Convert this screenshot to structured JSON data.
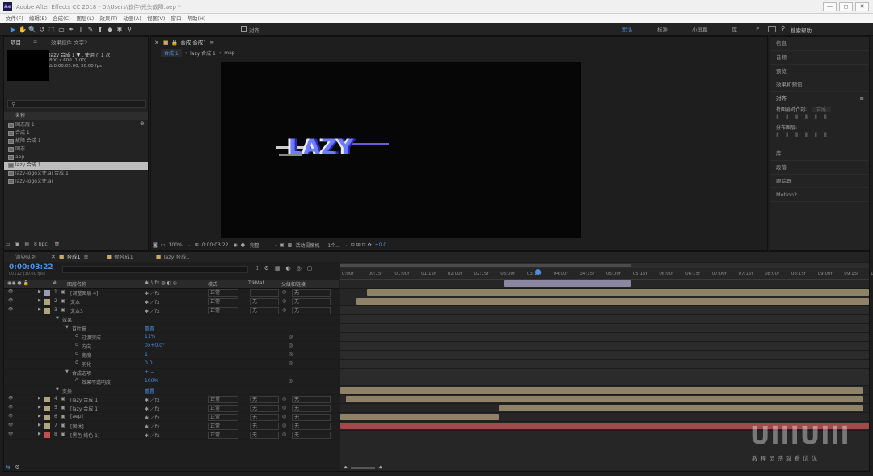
{
  "window": {
    "app_icon": "Ae",
    "title": "Adobe After Effects CC 2018 - D:\\Users\\软件\\光头故障.aep *",
    "min": "—",
    "max": "◻",
    "close": "✕"
  },
  "menu": [
    "文件(F)",
    "编辑(E)",
    "合成(C)",
    "图层(L)",
    "效果(T)",
    "动画(A)",
    "视图(V)",
    "窗口",
    "帮助(H)"
  ],
  "toolbar": {
    "tools": [
      "▶",
      "✋",
      "🔍",
      "↺",
      "⬚",
      "▭",
      "✒",
      "T",
      "✎",
      "⬆",
      "◆",
      "✱",
      "⚲"
    ],
    "snap_label": "对齐",
    "workspaces": [
      "默认",
      "标准",
      "小屏幕",
      "库"
    ],
    "active_ws": "默认",
    "more": "»",
    "search_placeholder": "搜索帮助"
  },
  "project": {
    "tab": "项目",
    "tab2": "效果控件 文字2",
    "comp_name": "lazy 合成 1 ▼ , 使用了 1 次",
    "comp_dims": "800 x 600 (1.00)",
    "comp_dur": "Δ 0:00:05:00, 30.00 fps",
    "col_name": "名称",
    "items": [
      "固态层 1",
      "合成 1",
      "故障 合成 1",
      "固态",
      "aep",
      "lazy 合成 1",
      "lazy-logo文件.ai 合成 1",
      "lazy-logo文件.ai"
    ],
    "selected_index": 5,
    "bpc": "8 bpc"
  },
  "viewer": {
    "tab": "合成 合成1",
    "breadcrumbs": [
      "合成 1",
      "lazy 合成 1",
      "map"
    ],
    "canvas_text": "LAZY",
    "zoom": "100%",
    "timecode": "0:00:03:22",
    "quality": "完整",
    "camera": "活动摄像机",
    "views": "1个...",
    "exposure": "+0.0"
  },
  "right_panel": {
    "items": [
      "信息",
      "音频",
      "预览",
      "效果和预设"
    ],
    "align": "对齐",
    "align_to_label": "将图层对齐到:",
    "align_to_value": "合成",
    "distribute": "分布图层:",
    "more_items": [
      "库",
      "段落",
      "跟踪器",
      "Motion2"
    ]
  },
  "timeline": {
    "tab_render": "渲染队列",
    "tabs": [
      "合成1",
      "预合成1",
      "lazy 合成1"
    ],
    "timecode": "0:00:03:22",
    "frame": "00112 (30.00 fps)",
    "col_headers": {
      "num": "#",
      "name": "图层名称",
      "mode": "模式",
      "trkmat": "TrkMat",
      "parent": "父级和链接"
    },
    "ruler": [
      "0:00f",
      "00:15f",
      "01:00f",
      "01:15f",
      "02:00f",
      "02:15f",
      "03:00f",
      "03:15f",
      "04:00f",
      "04:15f",
      "05:00f",
      "05:15f",
      "06:00f",
      "06:15f",
      "07:00f",
      "07:15f",
      "08:00f",
      "08:15f",
      "09:00f",
      "09:15f",
      "10:0"
    ],
    "layers": [
      {
        "num": "1",
        "name": "[调整图层 4]",
        "mode": "正常",
        "trk": "",
        "parent": "无",
        "color": "#9b9bb8",
        "bar_start": 0.31,
        "bar_end": 0.55,
        "bar_color": "#8b87a0"
      },
      {
        "num": "2",
        "name": "文本",
        "mode": "正常",
        "trk": "无",
        "parent": "无",
        "color": "#b2a47f",
        "bar_start": 0.05,
        "bar_end": 1.0
      },
      {
        "num": "3",
        "name": "文本3",
        "mode": "正常",
        "trk": "无",
        "parent": "无",
        "color": "#b2a47f",
        "bar_start": 0.03,
        "bar_end": 1.0
      },
      {
        "num": "4",
        "name": "[lazy 合成 1]",
        "mode": "正常",
        "trk": "无",
        "parent": "无",
        "color": "#b2a47f",
        "bar_start": 0.0,
        "bar_end": 0.99
      },
      {
        "num": "5",
        "name": "[lazy 合成 1]",
        "mode": "正常",
        "trk": "无",
        "parent": "无",
        "color": "#b2a47f",
        "bar_start": 0.01,
        "bar_end": 0.99
      },
      {
        "num": "6",
        "name": "[aep]",
        "mode": "正常",
        "trk": "无",
        "parent": "无",
        "color": "#b2a47f",
        "bar_start": 0.3,
        "bar_end": 0.99
      },
      {
        "num": "7",
        "name": "[固体]",
        "mode": "正常",
        "trk": "无",
        "parent": "无",
        "color": "#b2a47f",
        "bar_start": 0.0,
        "bar_end": 0.3
      },
      {
        "num": "8",
        "name": "[黑色 纯色 1]",
        "mode": "正常",
        "trk": "无",
        "parent": "无",
        "color": "#c05050",
        "bar_start": 0.0,
        "bar_end": 1.0,
        "bar_color": "#a04b4b"
      }
    ],
    "effect_rows": [
      {
        "name": "效果",
        "val": "",
        "indent": 0
      },
      {
        "name": "百叶窗",
        "val": "重置",
        "indent": 1
      },
      {
        "name": "过渡完成",
        "val": "11%",
        "indent": 2
      },
      {
        "name": "方向",
        "val": "0x+0.0°",
        "indent": 2
      },
      {
        "name": "宽度",
        "val": "1",
        "indent": 2
      },
      {
        "name": "羽化",
        "val": "0.0",
        "indent": 2
      },
      {
        "name": "合成选项",
        "val": "+ −",
        "indent": 1
      },
      {
        "name": "效果不透明度",
        "val": "100%",
        "indent": 2
      },
      {
        "name": "变换",
        "val": "重置",
        "indent": 0
      }
    ],
    "playhead_fraction": 0.373
  },
  "watermark": {
    "logo": "UIIIUIII",
    "caption": "教程灵感就看优优"
  }
}
